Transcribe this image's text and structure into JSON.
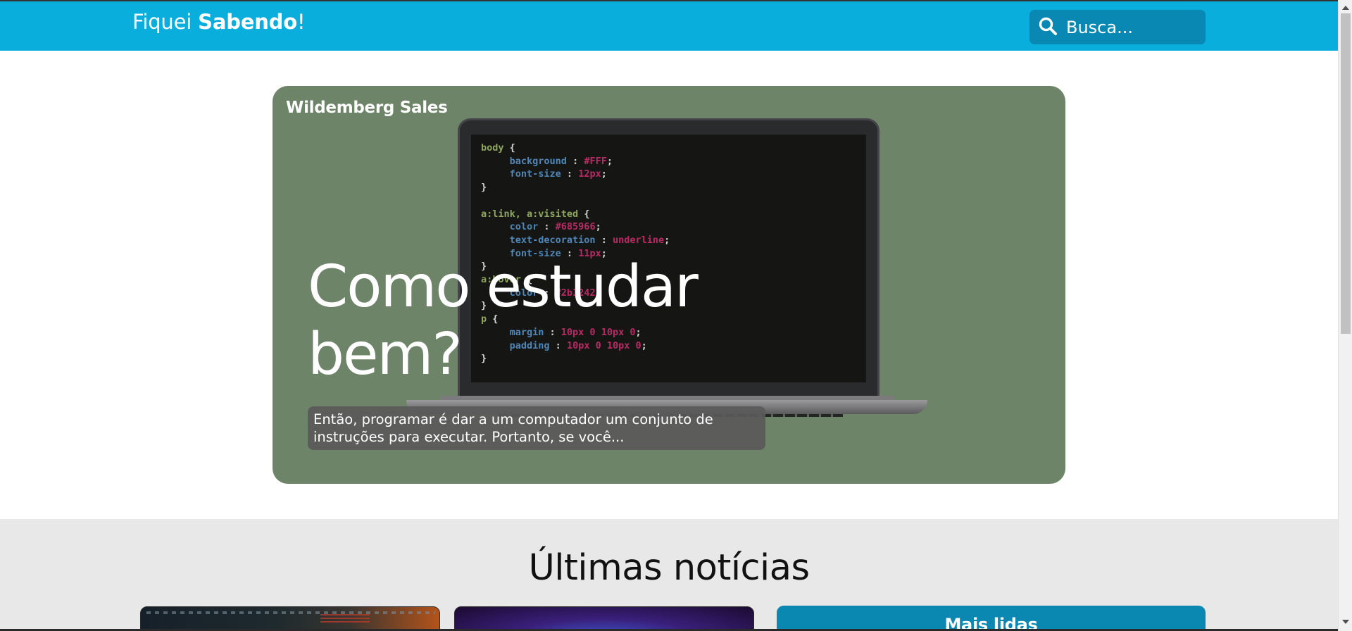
{
  "header": {
    "brand_regular": "Fiquei ",
    "brand_bold": "Sabendo",
    "brand_suffix": "!",
    "search_placeholder": "Busca..."
  },
  "hero": {
    "author": "Wildemberg Sales",
    "title": "Como estudar bem?",
    "excerpt": "Então, programar é dar a um computador um conjunto de instruções para executar. Portanto, se você..."
  },
  "code_image": {
    "lines": [
      {
        "sel": "body {"
      },
      {
        "prop": "background",
        "val": "#FFF"
      },
      {
        "prop": "font-size",
        "val": "12px"
      },
      {
        "close": "}"
      },
      {
        "sel": "a:link, a:visited {"
      },
      {
        "prop": "color",
        "val": "#685966"
      },
      {
        "prop": "text-decoration",
        "val": "underline"
      },
      {
        "prop": "font-size",
        "val": "11px"
      },
      {
        "close": "}"
      },
      {
        "sel": "a:hover {"
      },
      {
        "prop": "color",
        "val": "#2b1242"
      },
      {
        "close": "}"
      },
      {
        "sel": "p {"
      },
      {
        "prop": "margin",
        "val": "10px 0 10px 0"
      },
      {
        "prop": "padding",
        "val": "10px 0 10px 0"
      },
      {
        "close": "}"
      }
    ]
  },
  "news": {
    "heading": "Últimas notícias",
    "most_read_title": "Mais lidas"
  },
  "colors": {
    "header_bg": "#0aaedc",
    "search_bg": "#0888b3",
    "hero_bg": "#6e8469",
    "section_bg": "#e8e8e8",
    "most_read_bg": "#0a88b2"
  },
  "icons": {
    "search": "search-icon"
  }
}
